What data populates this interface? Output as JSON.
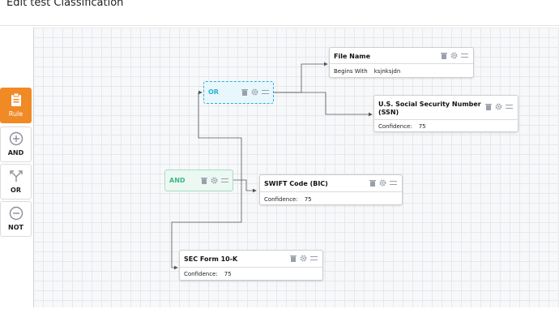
{
  "page": {
    "title": "Edit test Classification"
  },
  "palette": {
    "items": [
      {
        "label": "Rule",
        "icon": "clipboard-icon",
        "active": true
      },
      {
        "label": "AND",
        "icon": "plus-circle-icon",
        "active": false
      },
      {
        "label": "OR",
        "icon": "split-arrows-icon",
        "active": false
      },
      {
        "label": "NOT",
        "icon": "minus-circle-icon",
        "active": false
      }
    ]
  },
  "nodes": {
    "or_node": {
      "label": "OR"
    },
    "and_node": {
      "label": "AND"
    },
    "file_name": {
      "title": "File Name",
      "condition": "Begins With",
      "value": "ksjnksjdn"
    },
    "ssn": {
      "title": "U.S. Social Security Number (SSN)",
      "condition": "Confidence:",
      "value": "75"
    },
    "swift": {
      "title": "SWIFT Code (BIC)",
      "condition": "Confidence:",
      "value": "75"
    },
    "sec_form": {
      "title": "SEC Form 10-K",
      "condition": "Confidence:",
      "value": "75"
    }
  },
  "colors": {
    "rule_active": "#f08a25",
    "or_accent": "#2bb3d6",
    "and_accent": "#3fb88a",
    "icon_gray": "#9aa0aa"
  }
}
